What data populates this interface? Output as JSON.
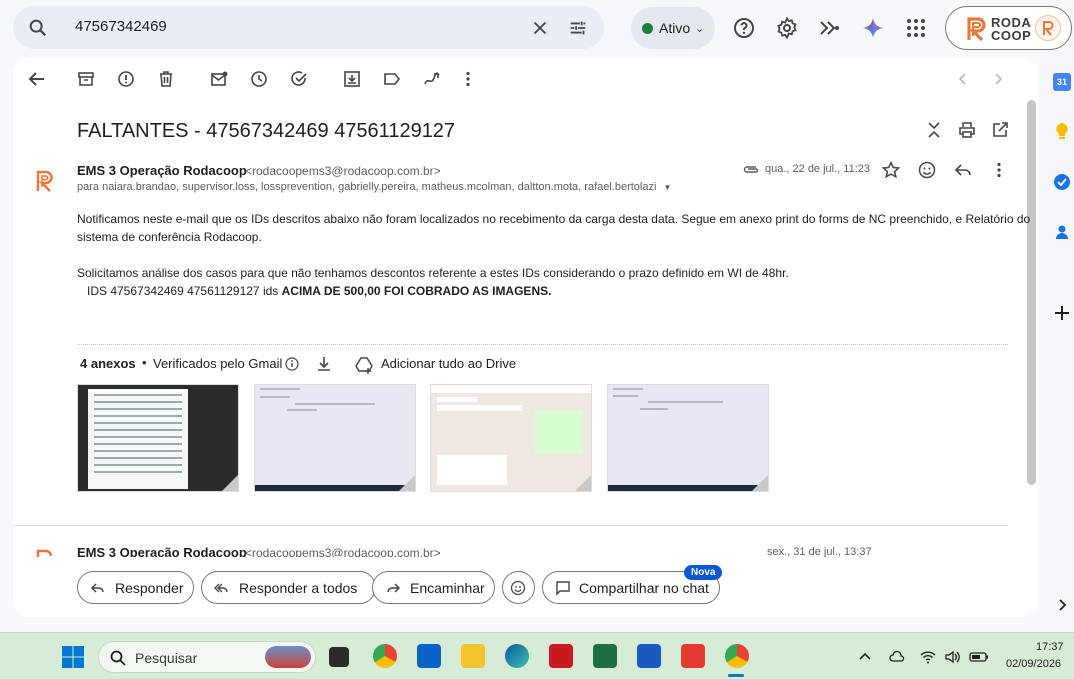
{
  "search": {
    "query": "47567342469"
  },
  "status": {
    "label": "Ativo"
  },
  "brand": {
    "line1": "RODA",
    "line2": "COOP"
  },
  "email": {
    "subject": "FALTANTES - 47567342469 47561129127",
    "sender_name": "EMS 3 Operação Rodacoop",
    "sender_email": "<rodacoopems3@rodacoop.com.br>",
    "recipients": "para naiara.brandao, supervisor.loss, lossprevention, gabrielly.pereira, matheus.mcolman, daltton.mota, rafael.bertolazi",
    "date": "qua., 22 de jul., 11:23",
    "body_p1_line1": "Notificamos neste e-mail que os IDs descritos abaixo não foram localizados no recebimento da carga desta data. Segue em anexo print do forms de NC preenchido, e Relatório do",
    "body_p1_line2": "sistema de conferência Rodacoop.",
    "body_p2": "Solicitamos análise dos casos para que não tenhamos descontos referente a estes IDs considerando o prazo definido em WI de 48hr.",
    "body_p3_plain": "IDS 47567342469 47561129127 ids ",
    "body_p3_bold": "ACIMA DE 500,00 FOI COBRADO AS IMAGENS."
  },
  "attachments": {
    "count_label": "4 anexos",
    "verified_label": "Verificados pelo Gmail",
    "add_drive_label": "Adicionar tudo ao Drive"
  },
  "email2": {
    "sender_name": "EMS 3 Operação Rodacoop",
    "sender_email": "<rodacoopems3@rodacoop.com.br>",
    "date": "sex., 31 de jul., 13:37"
  },
  "actions": {
    "reply": "Responder",
    "reply_all": "Responder a todos",
    "forward": "Encaminhar",
    "share_chat": "Compartilhar no chat",
    "new_badge": "Nova"
  },
  "taskbar": {
    "search_placeholder": "Pesquisar",
    "time": "17:37",
    "date": "02/09/2026"
  },
  "colors": {
    "accent_blue": "#0b57d0",
    "status_green": "#188038",
    "brand_orange": "#e8773a",
    "taskbar_bg": "#d6ecd4"
  }
}
